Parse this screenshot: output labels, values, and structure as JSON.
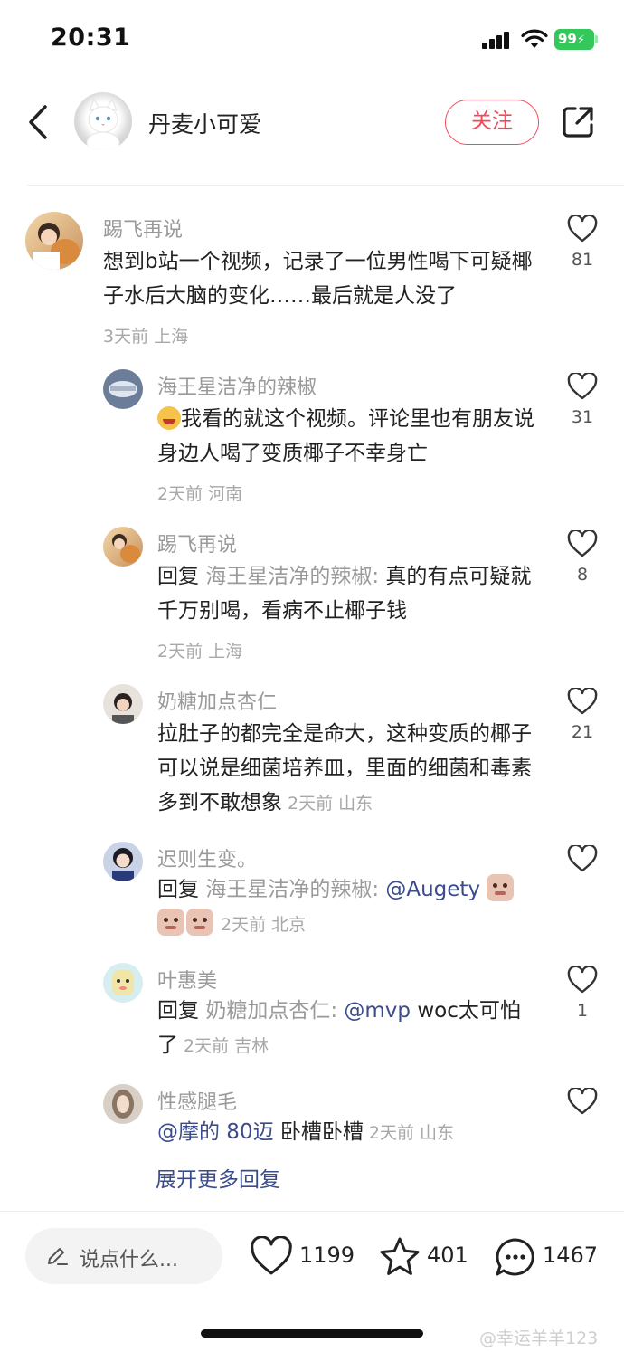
{
  "status_bar": {
    "time": "20:31",
    "battery": "99"
  },
  "header": {
    "author": "丹麦小可爱",
    "follow_label": "关注"
  },
  "comments": [
    {
      "name": "踢飞再说",
      "text": "想到b站一个视频，记录了一位男性喝下可疑椰子水后大脑的变化……最后就是人没了",
      "time": "3天前",
      "location": "上海",
      "likes": "81"
    },
    {
      "name": "海王星洁净的辣椒",
      "text": "我看的就这个视频。评论里也有朋友说身边人喝了变质椰子不幸身亡",
      "time": "2天前",
      "location": "河南",
      "likes": "31"
    },
    {
      "name": "踢飞再说",
      "reply_prefix": "回复",
      "reply_target": "海王星洁净的辣椒:",
      "text": "真的有点可疑就千万别喝，看病不止椰子钱",
      "time": "2天前",
      "location": "上海",
      "likes": "8"
    },
    {
      "name": "奶糖加点杏仁",
      "text": "拉肚子的都完全是命大，这种变质的椰子可以说是细菌培养皿，里面的细菌和毒素多到不敢想象",
      "time": "2天前",
      "location": "山东",
      "likes": "21"
    },
    {
      "name": "迟则生变。",
      "reply_prefix": "回复",
      "reply_target": "海王星洁净的辣椒:",
      "mention": "@Augety",
      "time": "2天前",
      "location": "北京",
      "likes": ""
    },
    {
      "name": "叶惠美",
      "reply_prefix": "回复",
      "reply_target": "奶糖加点杏仁:",
      "mention": "@mvp",
      "text": "woc太可怕了",
      "time": "2天前",
      "location": "吉林",
      "likes": "1"
    },
    {
      "name": "性感腿毛",
      "mention": "@摩的 80迈",
      "text": "卧槽卧槽",
      "time": "2天前",
      "location": "山东",
      "likes": ""
    }
  ],
  "expand_label": "展开更多回复",
  "bottom_bar": {
    "input_placeholder": "说点什么...",
    "likes": "1199",
    "favorites": "401",
    "comments": "1467"
  },
  "watermark": "@幸运羊羊123",
  "colors": {
    "accent_red": "#f04b5b",
    "mention_blue": "#3b4c8c",
    "battery_green": "#34c759"
  }
}
